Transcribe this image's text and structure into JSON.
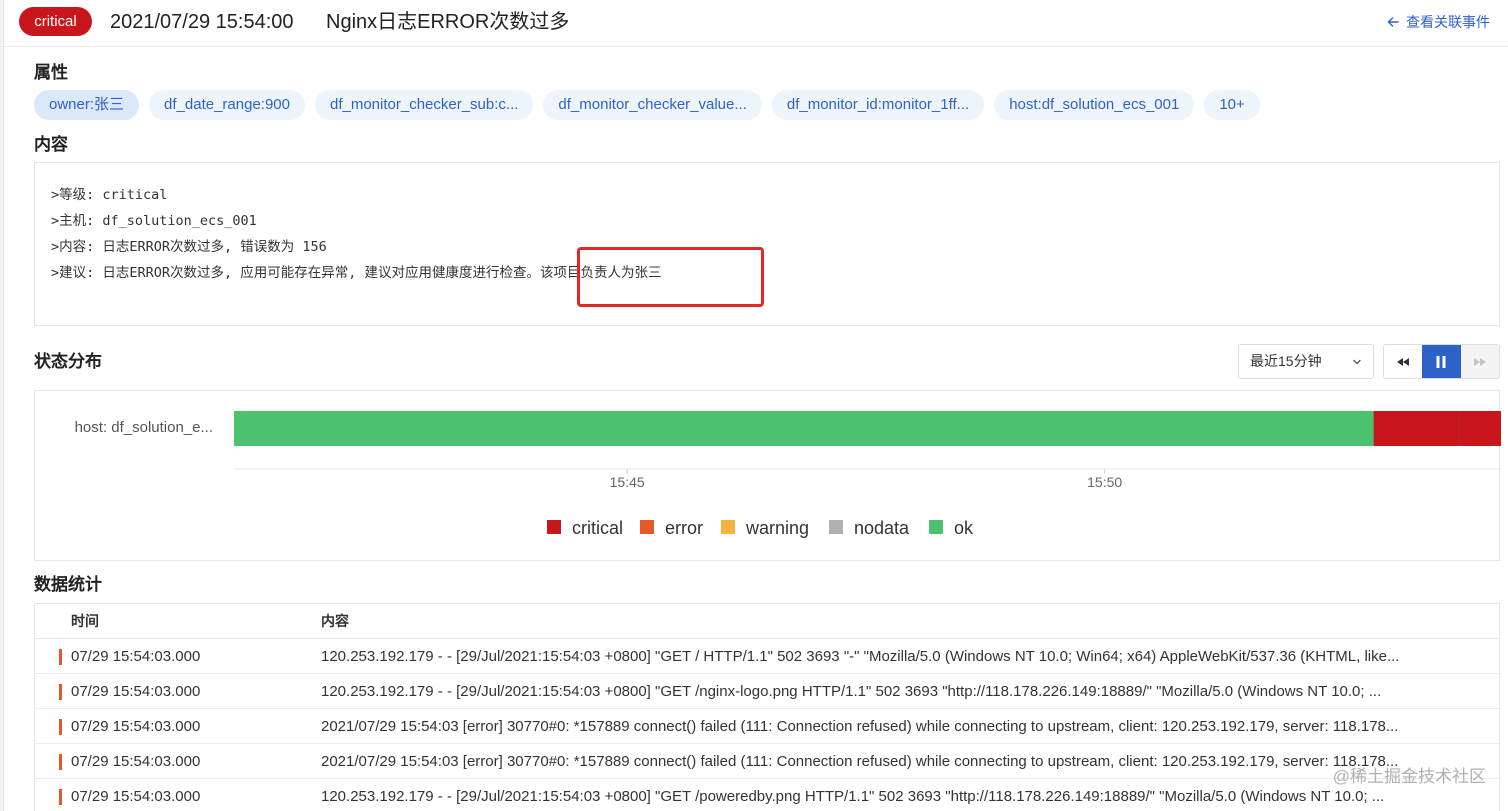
{
  "header": {
    "severity": "critical",
    "time": "2021/07/29 15:54:00",
    "title": "Nginx日志ERROR次数过多",
    "related_link": "查看关联事件"
  },
  "attributes": {
    "title": "属性",
    "chips": [
      "owner:张三",
      "df_date_range:900",
      "df_monitor_checker_sub:c...",
      "df_monitor_checker_value...",
      "df_monitor_id:monitor_1ff...",
      "host:df_solution_ecs_001",
      "10+"
    ]
  },
  "content": {
    "title": "内容",
    "lines": [
      ">等级: critical",
      ">主机: df_solution_ecs_001",
      ">内容: 日志ERROR次数过多, 错误数为 156",
      ">建议: 日志ERROR次数过多, 应用可能存在异常, 建议对应用健康度进行检查。该项目负责人为张三"
    ]
  },
  "status": {
    "title": "状态分布",
    "time_range": "最近15分钟",
    "icons": {
      "rewind": "rewind-icon",
      "pause": "pause-icon",
      "forward": "forward-icon"
    },
    "colors": {
      "critical": "#c9161c",
      "error": "#e8572a",
      "warning": "#f6b33f",
      "nodata": "#b0b0b0",
      "ok": "#4cc271"
    }
  },
  "chart_data": {
    "type": "bar",
    "categories": [
      "host: df_solution_e..."
    ],
    "x_ticks": [
      "15:45",
      "15:50"
    ],
    "legend": [
      "critical",
      "error",
      "warning",
      "nodata",
      "ok"
    ],
    "legend_position": "bottom",
    "segments": [
      {
        "status": "ok",
        "start": "15:40:53",
        "end": "15:52:49"
      },
      {
        "status": "critical",
        "start": "15:52:49",
        "end": "15:53:43"
      },
      {
        "status": "critical",
        "start": "15:53:43",
        "end": "15:54:09"
      }
    ]
  },
  "stats": {
    "title": "数据统计",
    "columns": [
      "时间",
      "内容"
    ],
    "rows": [
      {
        "time": "07/29 15:54:03.000",
        "message": "120.253.192.179 - - [29/Jul/2021:15:54:03 +0800] \"GET / HTTP/1.1\" 502 3693 \"-\" \"Mozilla/5.0 (Windows NT 10.0; Win64; x64) AppleWebKit/537.36 (KHTML, like..."
      },
      {
        "time": "07/29 15:54:03.000",
        "message": "120.253.192.179 - - [29/Jul/2021:15:54:03 +0800] \"GET /nginx-logo.png HTTP/1.1\" 502 3693 \"http://118.178.226.149:18889/\" \"Mozilla/5.0 (Windows NT 10.0; ..."
      },
      {
        "time": "07/29 15:54:03.000",
        "message": "2021/07/29 15:54:03 [error] 30770#0: *157889 connect() failed (111: Connection refused) while connecting to upstream, client: 120.253.192.179, server: 118.178..."
      },
      {
        "time": "07/29 15:54:03.000",
        "message": "2021/07/29 15:54:03 [error] 30770#0: *157889 connect() failed (111: Connection refused) while connecting to upstream, client: 120.253.192.179, server: 118.178..."
      },
      {
        "time": "07/29 15:54:03.000",
        "message": "120.253.192.179 - - [29/Jul/2021:15:54:03 +0800] \"GET /poweredby.png HTTP/1.1\" 502 3693 \"http://118.178.226.149:18889/\" \"Mozilla/5.0 (Windows NT 10.0; ..."
      }
    ]
  },
  "watermark": "@稀土掘金技术社区"
}
